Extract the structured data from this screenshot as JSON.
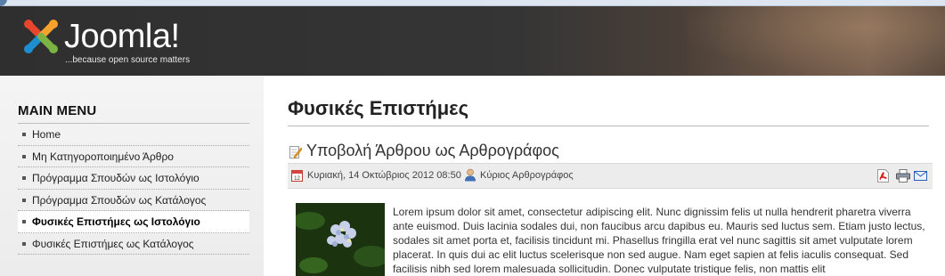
{
  "header": {
    "brand": "Joomla!",
    "brand_main": "Joomla!",
    "tagline": "...because open source matters"
  },
  "sidebar": {
    "title": "MAIN MENU",
    "items": [
      {
        "label": "Home"
      },
      {
        "label": "Μη Κατηγοροποιημένο Άρθρο"
      },
      {
        "label": "Πρόγραμμα Σπουδών ως Ιστολόγιο"
      },
      {
        "label": "Πρόγραμμα Σπουδών ως Κατάλογος"
      },
      {
        "label": "Φυσικές Επιστήμες ως Ιστολόγιο",
        "active": true
      },
      {
        "label": "Φυσικές Επιστήμες ως Κατάλογος"
      }
    ]
  },
  "main": {
    "page_title": "Φυσικές Επιστήμες",
    "article": {
      "title": "Υποβολή Άρθρου ως Αρθρογράφος",
      "date": "Κυριακή, 14 Οκτώβριος 2012 08:50",
      "author": "Κύριος Αρθρογράφος",
      "body": "Lorem ipsum dolor sit amet, consectetur adipiscing elit. Nunc dignissim felis ut nulla hendrerit pharetra viverra ante euismod. Duis lacinia sodales dui, non faucibus arcu dapibus eu. Mauris sed luctus sem. Etiam justo lectus, sodales sit amet porta et, facilisis tincidunt mi. Phasellus fringilla erat vel nunc sagittis sit amet vulputate lorem placerat. In quis dui ac elit luctus scelerisque non sed augue. Nam eget sapien at felis iaculis consequat. Sed facilisis nibh sed lorem malesuada sollicitudin. Donec vulputate tristique felis, non mattis elit"
    }
  },
  "icons": {
    "logo": "joomla-logo",
    "edit": "edit-article-icon",
    "calendar": "calendar-icon",
    "author": "user-icon",
    "pdf": "pdf-icon",
    "print": "print-icon",
    "email": "email-icon"
  },
  "colors": {
    "header_bg": "#2f2f2f",
    "sidebar_bg": "#f0f0f0",
    "meta_bg": "#ececec",
    "pdf_red": "#d0231c",
    "email_blue": "#2a5fb0"
  }
}
